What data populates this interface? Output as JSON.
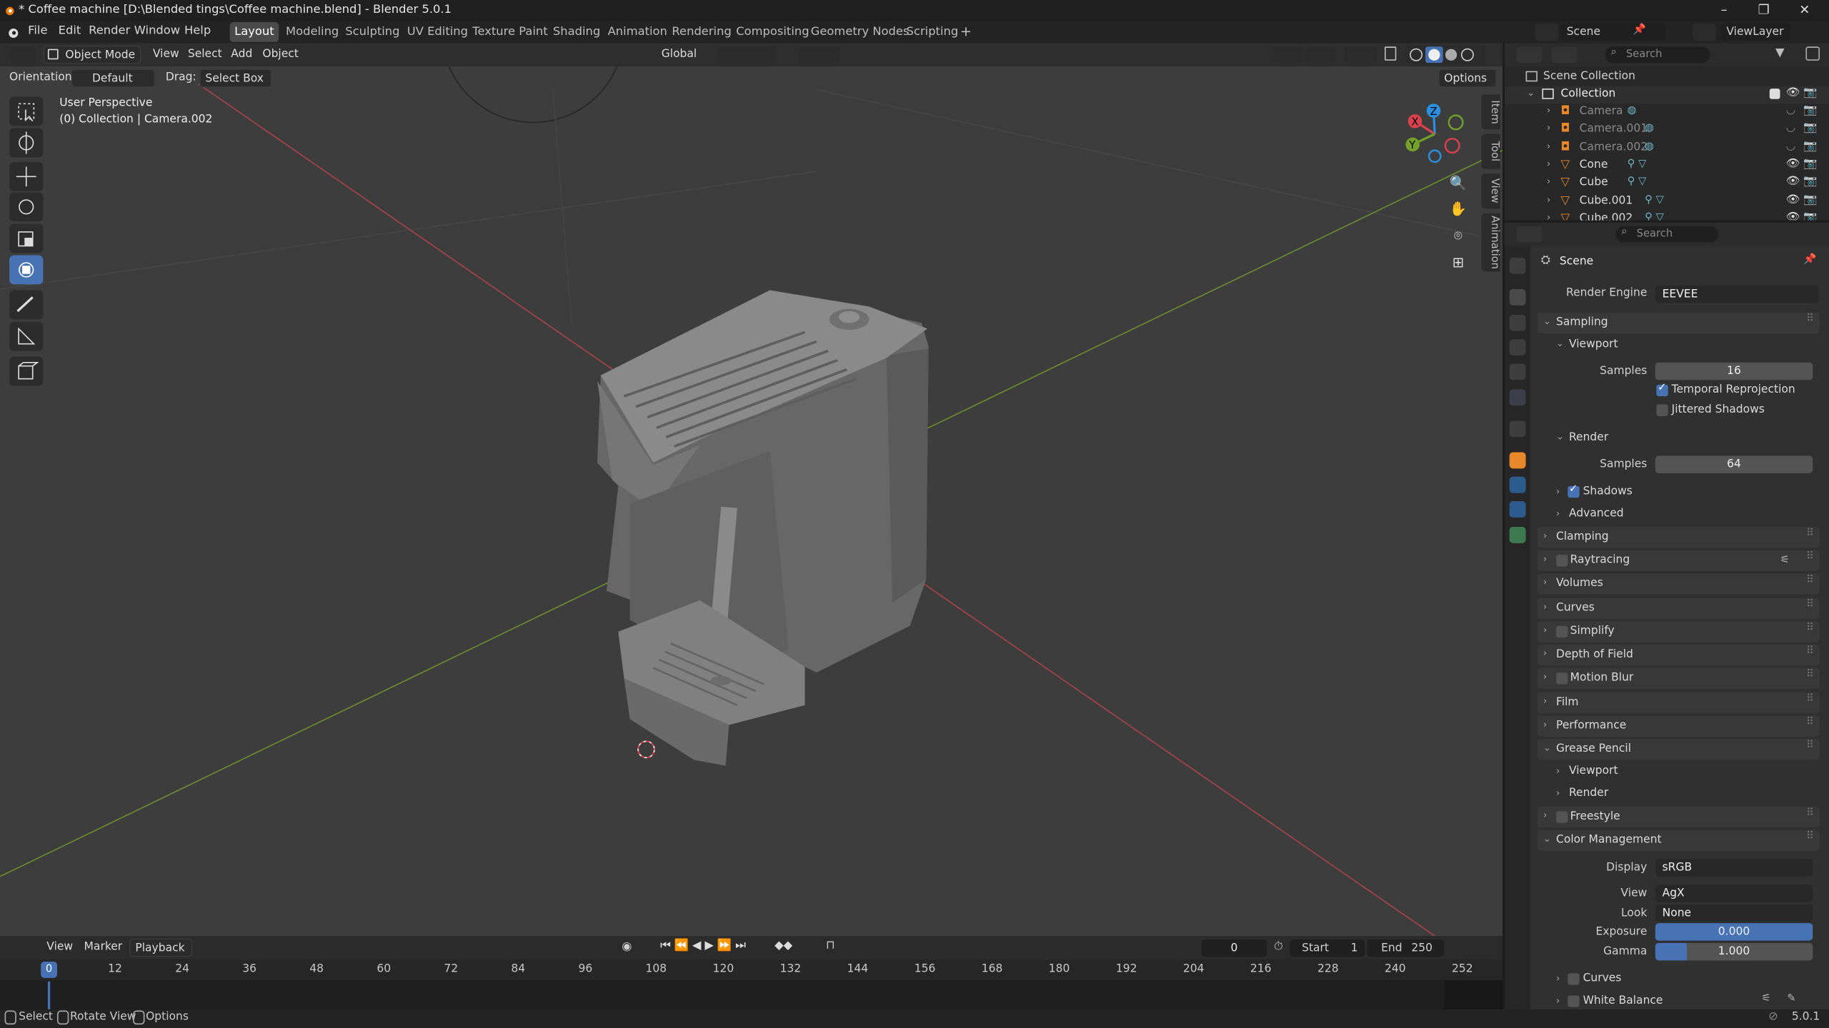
{
  "window": {
    "title": "* Coffee machine [D:\\Blended tings\\Coffee machine.blend] - Blender 5.0.1",
    "minimize": "–",
    "maximize": "❐",
    "close": "✕"
  },
  "menu": {
    "file": "File",
    "edit": "Edit",
    "render": "Render",
    "window": "Window",
    "help": "Help"
  },
  "workspaces": [
    "Layout",
    "Modeling",
    "Sculpting",
    "UV Editing",
    "Texture Paint",
    "Shading",
    "Animation",
    "Rendering",
    "Compositing",
    "Geometry Nodes",
    "Scripting"
  ],
  "workspace_add": "+",
  "scene": {
    "name": "Scene",
    "view_layer": "ViewLayer"
  },
  "viewport": {
    "mode": "Object Mode",
    "view": "View",
    "select": "Select",
    "add": "Add",
    "object": "Object",
    "transform_space": "Global",
    "orientation_label": "Orientation:",
    "orientation": "Default",
    "drag_label": "Drag:",
    "drag": "Select Box",
    "options": "Options",
    "overlay_title": "User Perspective",
    "overlay_sub": "(0) Collection | Camera.002",
    "npanel_tabs": [
      "Item",
      "Tool",
      "View",
      "Animation"
    ],
    "gizmo": {
      "x": "X",
      "y": "Y",
      "z": "Z"
    }
  },
  "timeline": {
    "view": "View",
    "marker": "Marker",
    "playback": "Playback",
    "current_frame": "0",
    "start_label": "Start",
    "start": "1",
    "end_label": "End",
    "end": "250",
    "ticks": [
      "0",
      "12",
      "24",
      "36",
      "48",
      "60",
      "72",
      "84",
      "96",
      "108",
      "120",
      "132",
      "144",
      "156",
      "168",
      "180",
      "192",
      "204",
      "216",
      "228",
      "240",
      "252"
    ]
  },
  "status": {
    "select": "Select",
    "rotate": "Rotate View",
    "options": "Options",
    "version": "5.0.1"
  },
  "outliner": {
    "search_placeholder": "Search",
    "root": "Scene Collection",
    "collection": "Collection",
    "items": [
      {
        "name": "Camera",
        "type": "camera",
        "dim": true
      },
      {
        "name": "Camera.001",
        "type": "camera",
        "dim": true
      },
      {
        "name": "Camera.002",
        "type": "camera",
        "dim": true
      },
      {
        "name": "Cone",
        "type": "mesh",
        "dim": false
      },
      {
        "name": "Cube",
        "type": "mesh",
        "dim": false
      },
      {
        "name": "Cube.001",
        "type": "mesh",
        "dim": false
      },
      {
        "name": "Cube.002",
        "type": "mesh",
        "dim": false
      }
    ]
  },
  "properties": {
    "search_placeholder": "Search",
    "context": "Scene",
    "render_engine_label": "Render Engine",
    "render_engine": "EEVEE",
    "sampling": "Sampling",
    "viewport": "Viewport",
    "samples_label": "Samples",
    "viewport_samples": "16",
    "temporal_reprojection": "Temporal Reprojection",
    "jittered_shadows": "Jittered Shadows",
    "render": "Render",
    "render_samples": "64",
    "shadows": "Shadows",
    "advanced": "Advanced",
    "clamping": "Clamping",
    "raytracing": "Raytracing",
    "volumes": "Volumes",
    "curves": "Curves",
    "simplify": "Simplify",
    "depth_of_field": "Depth of Field",
    "motion_blur": "Motion Blur",
    "film": "Film",
    "performance": "Performance",
    "grease_pencil": "Grease Pencil",
    "gp_viewport": "Viewport",
    "gp_render": "Render",
    "freestyle": "Freestyle",
    "color_management": "Color Management",
    "display_label": "Display",
    "display": "sRGB",
    "view_label": "View",
    "view": "AgX",
    "look_label": "Look",
    "look": "None",
    "exposure_label": "Exposure",
    "exposure": "0.000",
    "gamma_label": "Gamma",
    "gamma": "1.000",
    "cm_curves": "Curves",
    "white_balance": "White Balance"
  },
  "colors": {
    "accent": "#4772b3",
    "x_axis": "#d9424d",
    "y_axis": "#72a02a",
    "z_axis": "#2c8fe0",
    "selected_orange": "#e8882b"
  }
}
